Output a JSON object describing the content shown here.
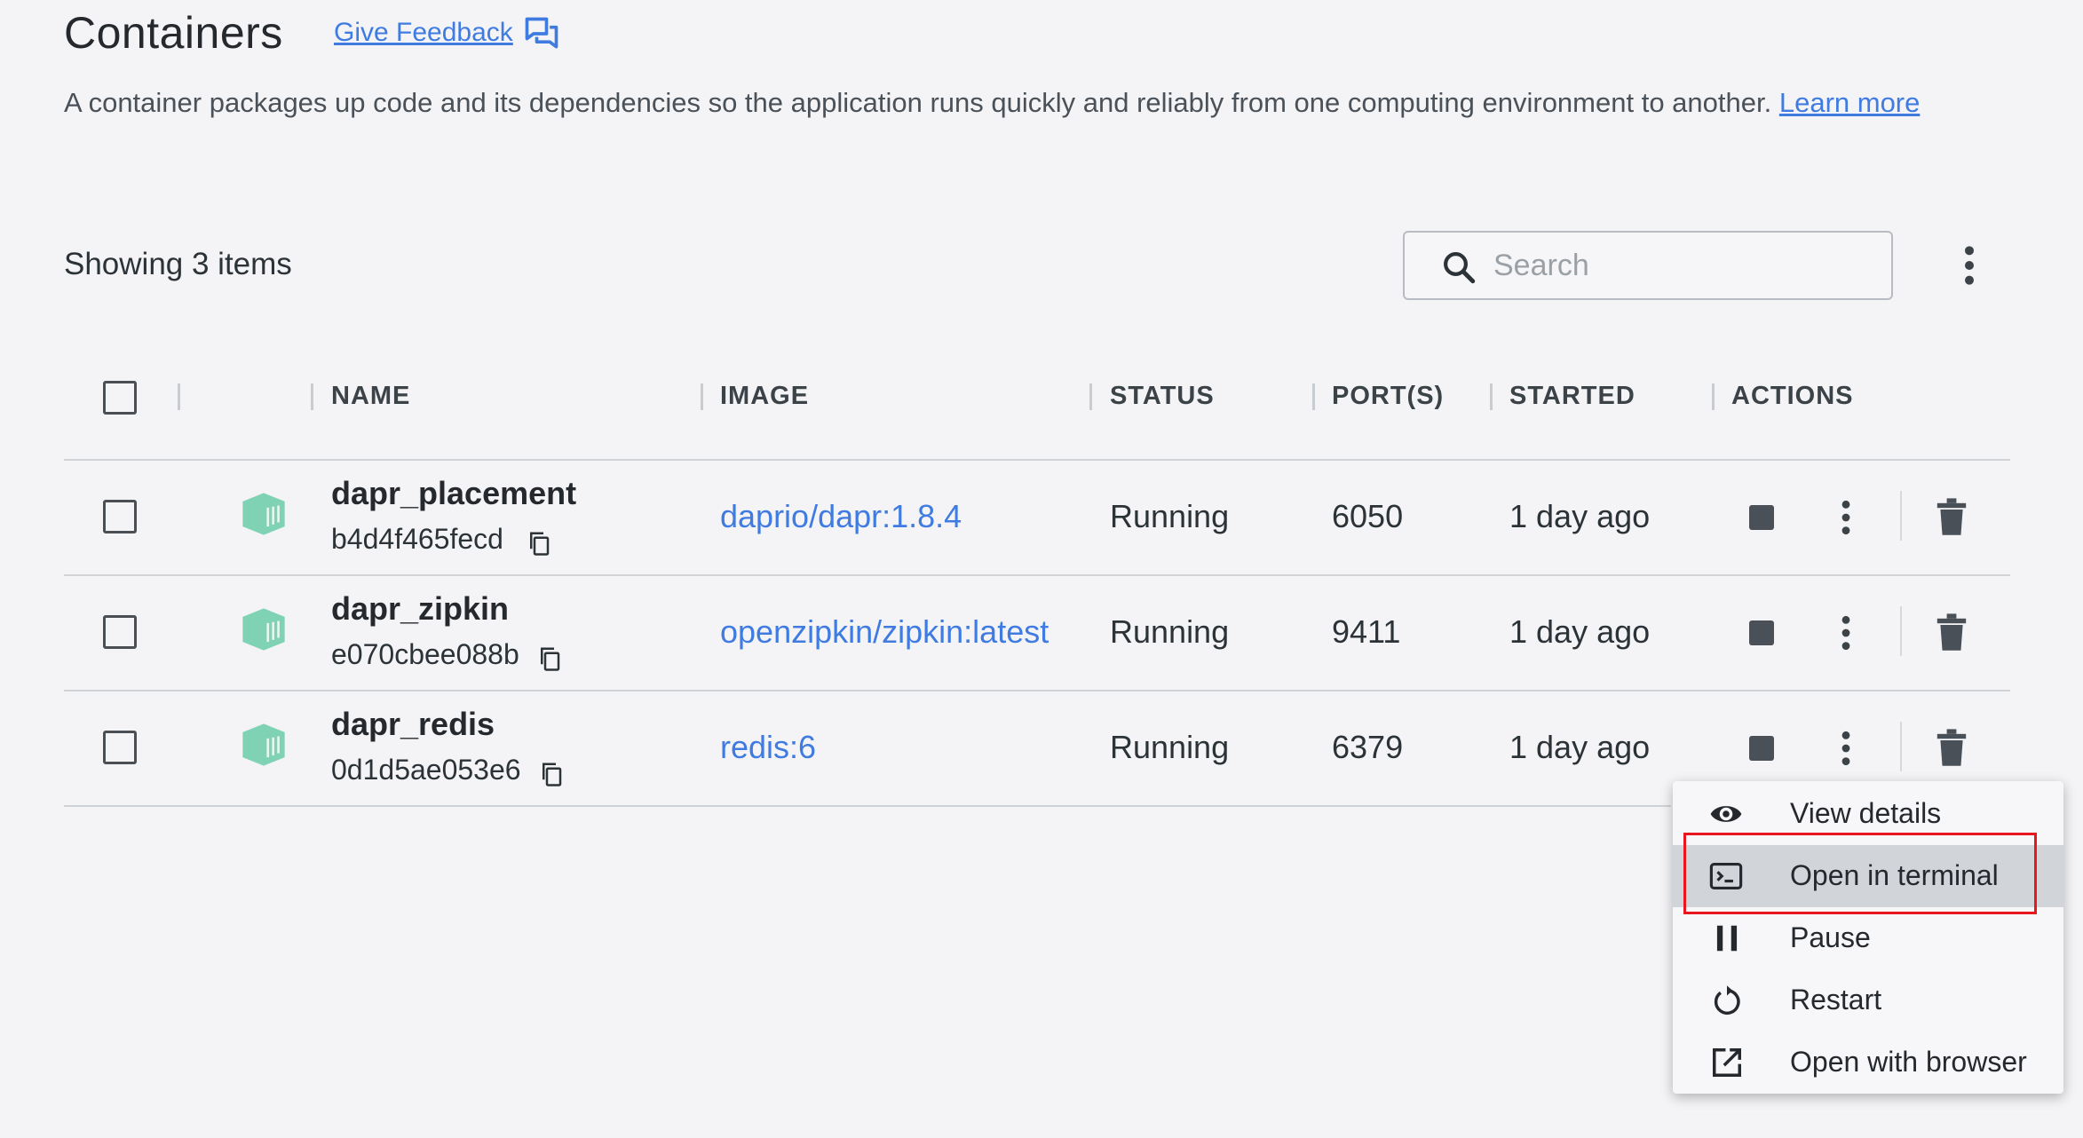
{
  "header": {
    "title": "Containers",
    "feedback_label": "Give Feedback",
    "description": "A container packages up code and its dependencies so the application runs quickly and reliably from one computing environment to another.",
    "learn_more": "Learn more"
  },
  "toolbar": {
    "showing": "Showing 3 items",
    "search_placeholder": "Search"
  },
  "table": {
    "headers": [
      "NAME",
      "IMAGE",
      "STATUS",
      "PORT(S)",
      "STARTED",
      "ACTIONS"
    ],
    "rows": [
      {
        "name": "dapr_placement",
        "id": "b4d4f465fecd",
        "image": "daprio/dapr:1.8.4",
        "status": "Running",
        "ports": "6050",
        "started": "1 day ago"
      },
      {
        "name": "dapr_zipkin",
        "id": "e070cbee088b",
        "image": "openzipkin/zipkin:latest",
        "status": "Running",
        "ports": "9411",
        "started": "1 day ago"
      },
      {
        "name": "dapr_redis",
        "id": "0d1d5ae053e6",
        "image": "redis:6",
        "status": "Running",
        "ports": "6379",
        "started": "1 day ago"
      }
    ]
  },
  "context_menu": {
    "items": [
      {
        "label": "View details",
        "icon": "eye-icon"
      },
      {
        "label": "Open in terminal",
        "icon": "terminal-icon",
        "highlighted": true
      },
      {
        "label": "Pause",
        "icon": "pause-icon"
      },
      {
        "label": "Restart",
        "icon": "restart-icon"
      },
      {
        "label": "Open with browser",
        "icon": "external-link-icon"
      }
    ]
  },
  "colors": {
    "accent": "#3f7be0",
    "container_icon": "#7fd3b4",
    "highlight_box": "#e8161d"
  }
}
